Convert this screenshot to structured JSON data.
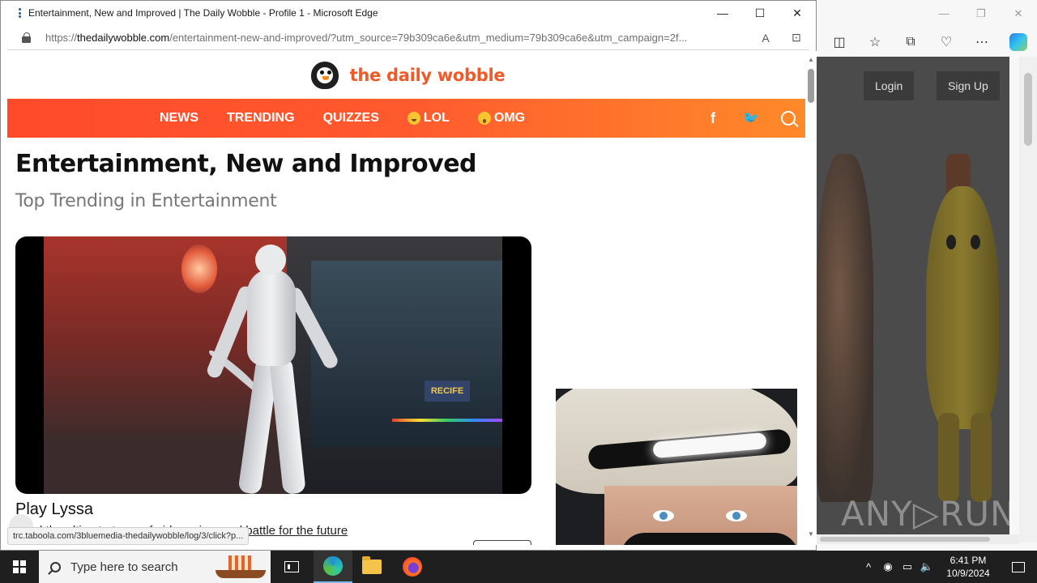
{
  "window": {
    "title": "Entertainment, New and Improved | The Daily Wobble - Profile 1 - Microsoft Edge",
    "minimize_glyph": "—",
    "maximize_glyph": "☐",
    "close_glyph": "✕"
  },
  "address_bar": {
    "url_prefix": "https://",
    "url_domain": "thedailywobble.com",
    "url_rest": "/entertainment-new-and-improved/?utm_source=79b309ca6e&utm_medium=79b309ca6e&utm_campaign=2f..."
  },
  "site": {
    "name": "the daily wobble",
    "nav": [
      {
        "label": "NEWS"
      },
      {
        "label": "TRENDING"
      },
      {
        "label": "QUIZZES"
      },
      {
        "label": "LOL",
        "icon": "laughing-emoji-icon"
      },
      {
        "label": "OMG",
        "icon": "shocked-emoji-icon"
      }
    ],
    "social": {
      "facebook": "f",
      "twitter": "🐦"
    }
  },
  "article": {
    "title": "Entertainment, New and Improved",
    "subtitle": "Top Trending in Entertainment",
    "video_title": "Play Lyssa",
    "video_desc": "Lead the ultimate team of girl warriors and battle for the future",
    "video_sign": "RECIFE"
  },
  "status_bar": {
    "text": "trc.taboola.com/3bluemedia-thedailywobble/log/3/click?p..."
  },
  "background_window": {
    "login_label": "Login",
    "signup_label": "Sign Up",
    "watermark": "ANY▷RUN"
  },
  "taskbar": {
    "search_placeholder": "Type here to search",
    "time": "6:41 PM",
    "date": "10/9/2024"
  }
}
